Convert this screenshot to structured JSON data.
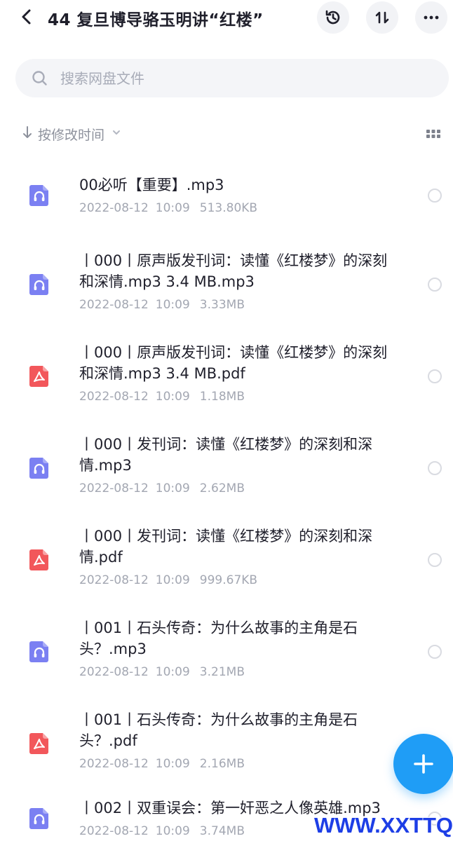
{
  "header": {
    "title": "44 复旦博导骆玉明讲“红楼”",
    "back_icon": "chevron-left-icon",
    "actions": [
      "history-icon",
      "sort-toggle-icon",
      "more-icon"
    ]
  },
  "search": {
    "placeholder": "搜索网盘文件"
  },
  "sort": {
    "label": "按修改时间"
  },
  "colors": {
    "audio_icon": "#7b80f2",
    "pdf_icon": "#f2575b",
    "fab": "#1f9df6",
    "watermark": "#1d3ee6"
  },
  "files": [
    {
      "type": "audio",
      "name": "00必听【重要】.mp3",
      "date": "2022-08-12",
      "time": "10:09",
      "size": "513.80KB"
    },
    {
      "type": "audio",
      "name": "丨000丨原声版发刊词：读懂《红楼梦》的深刻和深情.mp3 3.4 MB.mp3",
      "date": "2022-08-12",
      "time": "10:09",
      "size": "3.33MB"
    },
    {
      "type": "pdf",
      "name": "丨000丨原声版发刊词：读懂《红楼梦》的深刻和深情.mp3 3.4 MB.pdf",
      "date": "2022-08-12",
      "time": "10:09",
      "size": "1.18MB"
    },
    {
      "type": "audio",
      "name": "丨000丨发刊词：读懂《红楼梦》的深刻和深情.mp3",
      "date": "2022-08-12",
      "time": "10:09",
      "size": "2.62MB"
    },
    {
      "type": "pdf",
      "name": "丨000丨发刊词：读懂《红楼梦》的深刻和深情.pdf",
      "date": "2022-08-12",
      "time": "10:09",
      "size": "999.67KB"
    },
    {
      "type": "audio",
      "name": "丨001丨石头传奇：为什么故事的主角是石头？.mp3",
      "date": "2022-08-12",
      "time": "10:09",
      "size": "3.21MB"
    },
    {
      "type": "pdf",
      "name": "丨001丨石头传奇：为什么故事的主角是石头？.pdf",
      "date": "2022-08-12",
      "time": "10:09",
      "size": "2.16MB"
    },
    {
      "type": "audio",
      "name": "丨002丨双重误会：第一奸恶之人像英雄.mp3",
      "date": "2022-08-12",
      "time": "10:09",
      "size": "3.74MB"
    }
  ],
  "fab_icon": "plus-icon",
  "watermark": "WWW.XXTTQ.COM"
}
